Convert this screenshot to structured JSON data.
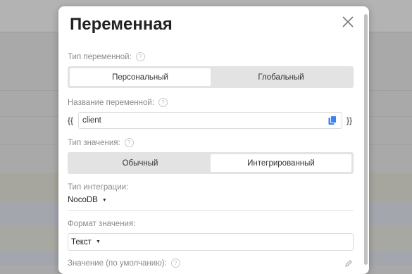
{
  "modal": {
    "title": "Переменная",
    "variable_type": {
      "label": "Тип переменной:",
      "options": [
        "Персональный",
        "Глобальный"
      ],
      "selected": "Персональный"
    },
    "variable_name": {
      "label": "Название переменной:",
      "open_brace": "{{",
      "close_brace": "}}",
      "value": "client"
    },
    "value_type": {
      "label": "Тип значения:",
      "options": [
        "Обычный",
        "Интегрированный"
      ],
      "selected": "Интегрированный"
    },
    "integration_type": {
      "label": "Тип интеграции:",
      "value": "NocoDB"
    },
    "value_format": {
      "label": "Формат значения:",
      "value": "Текст"
    },
    "default_value": {
      "label": "Значение (по умолчанию):"
    }
  },
  "colors": {
    "overlay": "#a9a9a9",
    "segment_bg": "#e3e3e3",
    "accent": "#3b82f6"
  },
  "icons": [
    "close-icon",
    "help-icon",
    "copy-icon",
    "chevron-down-icon",
    "edit-icon"
  ]
}
